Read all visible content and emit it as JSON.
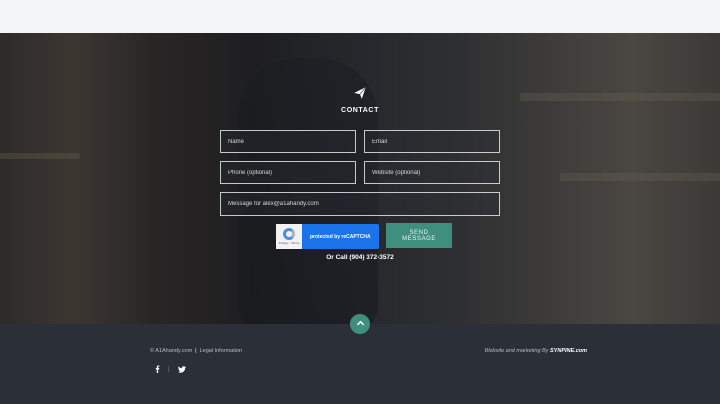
{
  "contact": {
    "title": "CONTACT",
    "name_placeholder": "Name",
    "email_placeholder": "Email",
    "phone_placeholder": "Phone (optional)",
    "website_placeholder": "Website (optional)",
    "message_placeholder": "Message for alex@a1ahandy.com",
    "recaptcha_label": "protected by reCAPTCHA",
    "recaptcha_terms": "Privacy - Terms",
    "send_label": "SEND MESSAGE",
    "call_text": "Or Call (904) 372-3572"
  },
  "footer": {
    "copyright": "© A1Ahandy.com",
    "separator": "|",
    "legal": "Legal Information",
    "credit_prefix": "Website and marketing By",
    "credit_brand": "SYNPINE.com",
    "social_divider": "|"
  },
  "colors": {
    "accent": "#3f8f7f",
    "footer_bg": "#2a2f38",
    "recaptcha_blue": "#1a73e8"
  }
}
